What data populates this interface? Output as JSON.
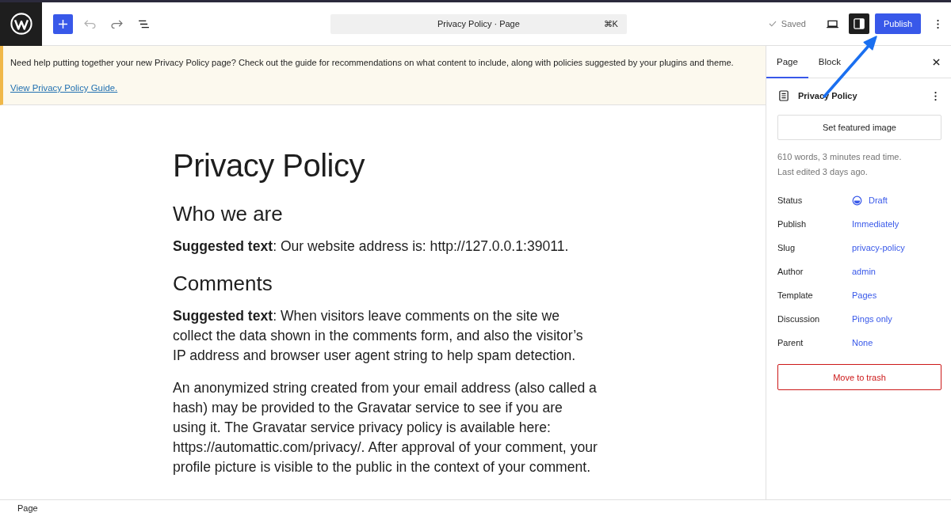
{
  "toolbar": {
    "undo": {
      "disabled": true
    },
    "redo": {
      "disabled": false
    },
    "command_bar": {
      "title": "Privacy Policy · Page",
      "shortcut": "⌘K"
    },
    "save_status": "Saved",
    "settings_toggle": {
      "pressed": true
    },
    "publish_button": "Publish"
  },
  "notice": {
    "text": "Need help putting together your new Privacy Policy page? Check out the guide for recommendations on what content to include, along with policies suggested by your plugins and theme.",
    "link": "View Privacy Policy Guide."
  },
  "editor": {
    "title": "Privacy Policy",
    "blocks": [
      {
        "kind": "heading",
        "text": "Who we are"
      },
      {
        "kind": "paragraph",
        "text": "**Suggested text**: Our website address is: http://127.0.0.1:39011."
      },
      {
        "kind": "heading",
        "text": "Comments"
      },
      {
        "kind": "paragraph",
        "text": "**Suggested text**: When visitors leave comments on the site we collect the data shown in the comments form, and also the visitor’s IP address and browser user agent string to help spam detection."
      },
      {
        "kind": "paragraph",
        "text": "An anonymized string created from your email address (also called a hash) may be provided to the Gravatar service to see if you are using it. The Gravatar service privacy policy is available here: https://automattic.com/privacy/. After approval of your comment, your profile picture is visible to the public in the context of your comment."
      }
    ]
  },
  "sidebar": {
    "tabs": [
      {
        "label": "Page",
        "selected": true
      },
      {
        "label": "Block",
        "selected": false
      }
    ],
    "post_title": "Privacy Policy",
    "featured_image_button": "Set featured image",
    "meta": [
      "610 words, 3 minutes read time.",
      "Last edited 3 days ago."
    ],
    "fields": [
      {
        "label": "Status",
        "value": "Draft",
        "kind": "status"
      },
      {
        "label": "Publish",
        "value": "Immediately",
        "kind": "link"
      },
      {
        "label": "Slug",
        "value": "privacy-policy",
        "kind": "link"
      },
      {
        "label": "Author",
        "value": "admin",
        "kind": "link"
      },
      {
        "label": "Template",
        "value": "Pages",
        "kind": "link"
      },
      {
        "label": "Discussion",
        "value": "Pings only",
        "kind": "link"
      },
      {
        "label": "Parent",
        "value": "None",
        "kind": "link"
      }
    ],
    "trash_button": "Move to trash"
  },
  "status_bar": {
    "breadcrumb": "Page"
  }
}
